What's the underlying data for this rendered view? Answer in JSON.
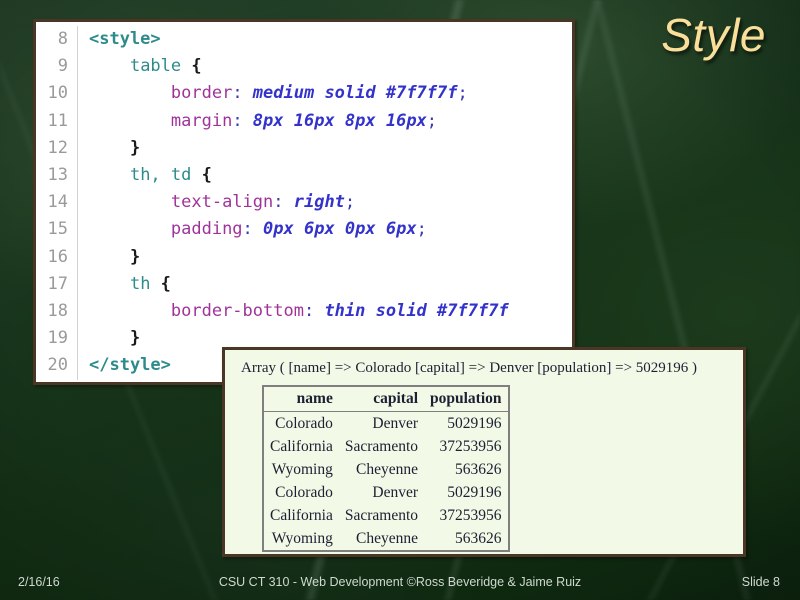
{
  "slide": {
    "title": "Style",
    "footer": {
      "date": "2/16/16",
      "center": "CSU CT 310 - Web Development ©Ross Beveridge & Jaime Ruiz",
      "slide_number": "Slide 8"
    },
    "colors": {
      "background_green": "#18351c",
      "title_gold": "#fadf9a",
      "panel_border_brown": "#4b3524",
      "output_background": "#f2f9e6",
      "table_border_gray": "#7f7f7f"
    }
  },
  "code": {
    "lines": [
      {
        "number": "8",
        "indent": "",
        "tokens": [
          {
            "text": "<style>",
            "cls": "t-tag"
          }
        ]
      },
      {
        "number": "9",
        "indent": "    ",
        "tokens": [
          {
            "text": "table ",
            "cls": "t-sel"
          },
          {
            "text": "{",
            "cls": "t-brace"
          }
        ]
      },
      {
        "number": "10",
        "indent": "        ",
        "tokens": [
          {
            "text": "border",
            "cls": "t-prop"
          },
          {
            "text": ": ",
            "cls": "t-punct"
          },
          {
            "text": "medium solid #7f7f7f",
            "cls": "t-val"
          },
          {
            "text": ";",
            "cls": "t-punct"
          }
        ]
      },
      {
        "number": "11",
        "indent": "        ",
        "tokens": [
          {
            "text": "margin",
            "cls": "t-prop"
          },
          {
            "text": ": ",
            "cls": "t-punct"
          },
          {
            "text": "8px 16px 8px 16px",
            "cls": "t-val"
          },
          {
            "text": ";",
            "cls": "t-punct"
          }
        ]
      },
      {
        "number": "12",
        "indent": "    ",
        "tokens": [
          {
            "text": "}",
            "cls": "t-brace"
          }
        ]
      },
      {
        "number": "13",
        "indent": "    ",
        "tokens": [
          {
            "text": "th, td ",
            "cls": "t-sel"
          },
          {
            "text": "{",
            "cls": "t-brace"
          }
        ]
      },
      {
        "number": "14",
        "indent": "        ",
        "tokens": [
          {
            "text": "text-align",
            "cls": "t-prop"
          },
          {
            "text": ": ",
            "cls": "t-punct"
          },
          {
            "text": "right",
            "cls": "t-val"
          },
          {
            "text": ";",
            "cls": "t-punct"
          }
        ]
      },
      {
        "number": "15",
        "indent": "        ",
        "tokens": [
          {
            "text": "padding",
            "cls": "t-prop"
          },
          {
            "text": ": ",
            "cls": "t-punct"
          },
          {
            "text": "0px 6px 0px 6px",
            "cls": "t-val"
          },
          {
            "text": ";",
            "cls": "t-punct"
          }
        ]
      },
      {
        "number": "16",
        "indent": "    ",
        "tokens": [
          {
            "text": "}",
            "cls": "t-brace"
          }
        ]
      },
      {
        "number": "17",
        "indent": "    ",
        "tokens": [
          {
            "text": "th ",
            "cls": "t-sel"
          },
          {
            "text": "{",
            "cls": "t-brace"
          }
        ]
      },
      {
        "number": "18",
        "indent": "        ",
        "tokens": [
          {
            "text": "border-bottom",
            "cls": "t-prop"
          },
          {
            "text": ": ",
            "cls": "t-punct"
          },
          {
            "text": "thin solid #7f7f7f",
            "cls": "t-val"
          }
        ]
      },
      {
        "number": "19",
        "indent": "    ",
        "tokens": [
          {
            "text": "}",
            "cls": "t-brace"
          }
        ]
      },
      {
        "number": "20",
        "indent": "",
        "tokens": [
          {
            "text": "</style>",
            "cls": "t-tag"
          }
        ]
      }
    ]
  },
  "output": {
    "array_dump": "Array ( [name] => Colorado [capital] => Denver [population] => 5029196 )",
    "table": {
      "headers": [
        "name",
        "capital",
        "population"
      ],
      "rows": [
        [
          "Colorado",
          "Denver",
          "5029196"
        ],
        [
          "California",
          "Sacramento",
          "37253956"
        ],
        [
          "Wyoming",
          "Cheyenne",
          "563626"
        ],
        [
          "Colorado",
          "Denver",
          "5029196"
        ],
        [
          "California",
          "Sacramento",
          "37253956"
        ],
        [
          "Wyoming",
          "Cheyenne",
          "563626"
        ]
      ]
    }
  }
}
